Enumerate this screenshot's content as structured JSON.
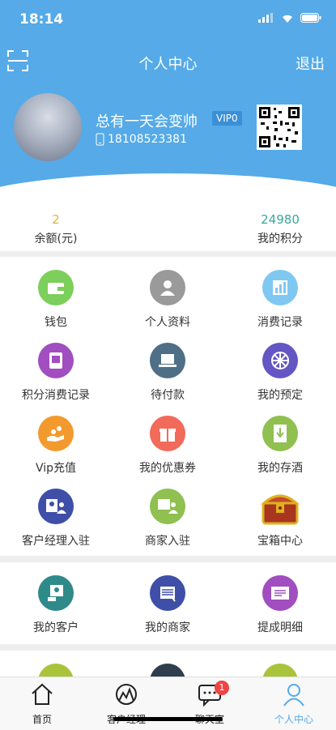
{
  "status": {
    "time": "18:14"
  },
  "header": {
    "scan_icon": "scan-icon",
    "title": "个人中心",
    "logout_label": "退出",
    "bg_color": "#55aae7"
  },
  "profile": {
    "name": "总有一天会变帅",
    "vip": "VIP0",
    "phone": "18108523381"
  },
  "stats": {
    "balance": {
      "value": "2",
      "label": "余额(元)",
      "color": "#e0b33a"
    },
    "points": {
      "value": "24980",
      "label": "我的积分",
      "color": "#3aa89a"
    }
  },
  "grid1": [
    {
      "label": "钱包",
      "icon": "wallet-icon",
      "color": "#7ccf5a"
    },
    {
      "label": "个人资料",
      "icon": "profile-icon",
      "color": "#9a9a9a"
    },
    {
      "label": "消费记录",
      "icon": "chart-icon",
      "color": "#7fc8f2"
    },
    {
      "label": "积分消费记录",
      "icon": "tablet-icon",
      "color": "#a04ec0"
    },
    {
      "label": "待付款",
      "icon": "laptop-icon",
      "color": "#4f6f86"
    },
    {
      "label": "我的预定",
      "icon": "wheel-icon",
      "color": "#6456c3"
    },
    {
      "label": "Vip充值",
      "icon": "coins-icon",
      "color": "#f39a2f"
    },
    {
      "label": "我的优惠券",
      "icon": "gift-icon",
      "color": "#f26a5a"
    },
    {
      "label": "我的存酒",
      "icon": "download-icon",
      "color": "#8fc050"
    },
    {
      "label": "客户经理入驻",
      "icon": "manager-icon",
      "color": "#3f4fa8"
    },
    {
      "label": "商家入驻",
      "icon": "merchant-icon",
      "color": "#8fc050"
    },
    {
      "label": "宝箱中心",
      "icon": "treasure-chest-icon",
      "color": "#c44a2a"
    }
  ],
  "grid2": [
    {
      "label": "我的客户",
      "icon": "customer-icon",
      "color": "#2f8a8a"
    },
    {
      "label": "我的商家",
      "icon": "store-icon",
      "color": "#3f4fa8"
    },
    {
      "label": "提成明细",
      "icon": "card-icon",
      "color": "#a04ec0"
    }
  ],
  "tabs": [
    {
      "label": "首页",
      "icon": "home-icon"
    },
    {
      "label": "客户经理",
      "icon": "manager-tab-icon"
    },
    {
      "label": "聊天室",
      "icon": "chat-icon",
      "badge": "1"
    },
    {
      "label": "个人中心",
      "icon": "person-icon",
      "active_color": "#55aae7"
    }
  ]
}
